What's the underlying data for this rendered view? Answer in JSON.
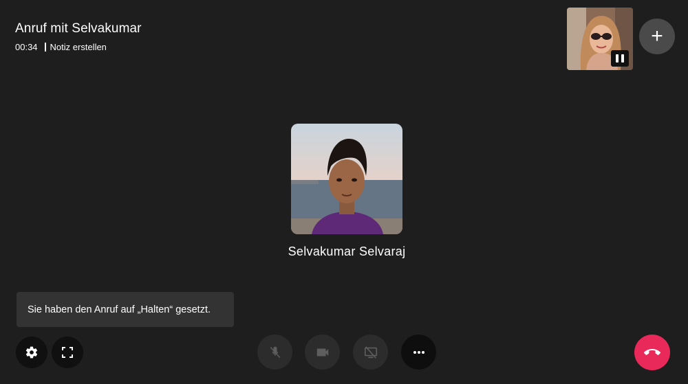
{
  "call": {
    "title": "Anruf mit Selvakumar",
    "duration": "00:34",
    "note_link": "Notiz erstellen"
  },
  "callee": {
    "name": "Selvakumar Selvaraj"
  },
  "toast": {
    "message": "Sie haben den Anruf auf „Halten“ gesetzt."
  },
  "buttons": {
    "add": "+"
  },
  "icons": {
    "settings": "settings-icon",
    "fullscreen": "fullscreen-icon",
    "mic_off": "mic-off-icon",
    "camera": "camera-icon",
    "screen_share_off": "screen-share-off-icon",
    "more": "more-horizontal-icon",
    "hang_up": "hang-up-icon",
    "pause": "pause-icon"
  },
  "colors": {
    "background": "#1e1e1e",
    "hang_up": "#e8295a",
    "toast": "#333333"
  }
}
